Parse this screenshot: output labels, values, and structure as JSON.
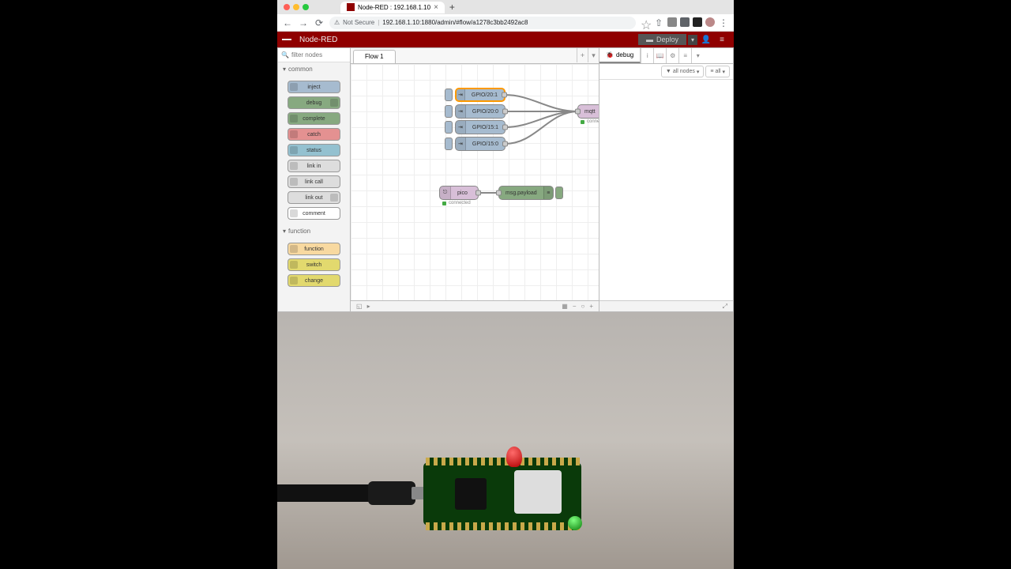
{
  "browser": {
    "tab_title": "Node-RED : 192.168.1.10",
    "not_secure": "Not Secure",
    "url": "192.168.1.10:1880/admin/#flow/a1278c3bb2492ac8"
  },
  "header": {
    "app_name": "Node-RED",
    "deploy": "Deploy"
  },
  "palette": {
    "filter_placeholder": "filter nodes",
    "categories": [
      {
        "name": "common",
        "nodes": [
          "inject",
          "debug",
          "complete",
          "catch",
          "status",
          "link in",
          "link call",
          "link out",
          "comment"
        ]
      },
      {
        "name": "function",
        "nodes": [
          "function",
          "switch",
          "change"
        ]
      }
    ]
  },
  "workspace": {
    "tab": "Flow 1",
    "nodes": {
      "gpio20_1": "GPIO/20:1",
      "gpio20_0": "GPIO/20:0",
      "gpio15_1": "GPIO/15:1",
      "gpio15_0": "GPIO/15:0",
      "mqtt": "mqtt",
      "mqtt_status": "connected",
      "pico": "pico",
      "pico_status": "connected",
      "debug": "msg.payload"
    }
  },
  "sidebar": {
    "tab": "debug",
    "filter_nodes": "all nodes",
    "filter_all": "all"
  }
}
